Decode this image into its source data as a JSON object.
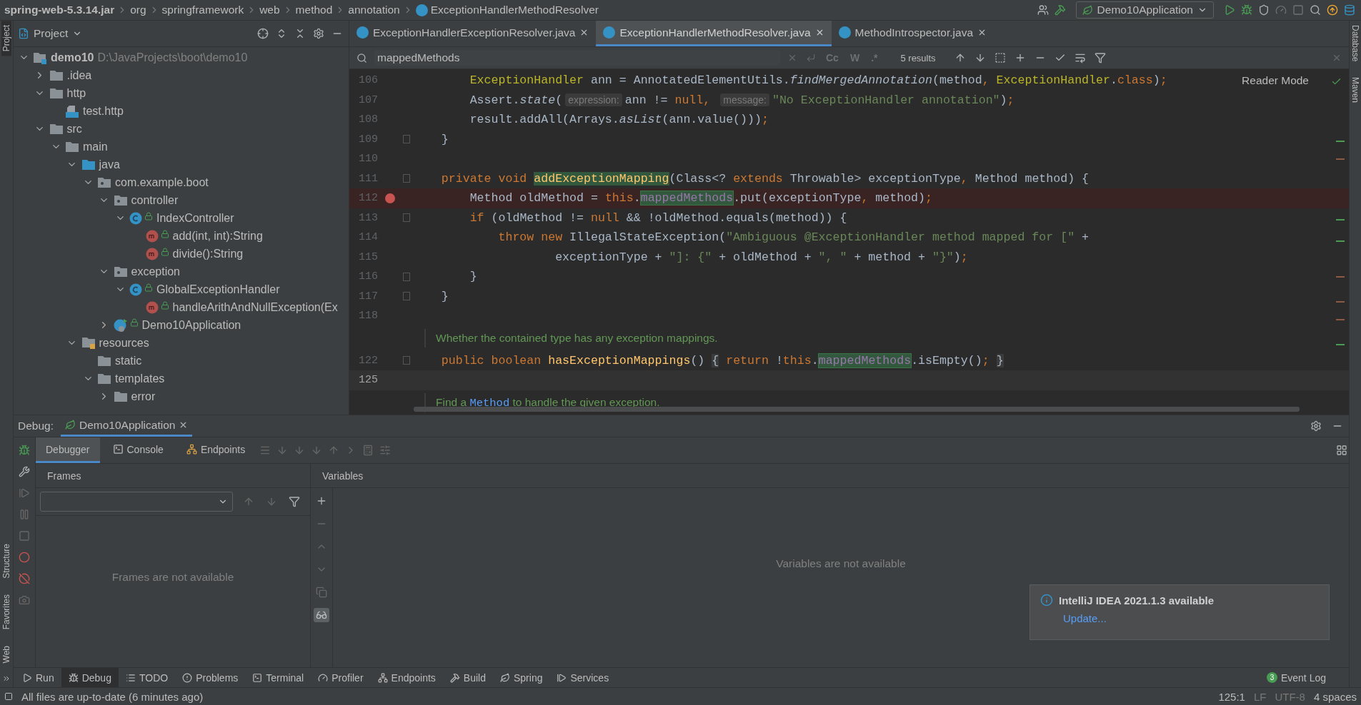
{
  "breadcrumbs": [
    "spring-web-5.3.14.jar",
    "org",
    "springframework",
    "web",
    "method",
    "annotation",
    "ExceptionHandlerMethodResolver"
  ],
  "run_config": "Demo10Application",
  "left_stripe": [
    {
      "label": "Project",
      "selected": true
    },
    {
      "label": "Structure",
      "selected": false
    },
    {
      "label": "Favorites",
      "selected": false
    },
    {
      "label": "Web",
      "selected": false
    }
  ],
  "right_stripe": [
    "Database",
    "Maven"
  ],
  "project_panel": {
    "title": "Project",
    "tree": [
      {
        "label": "demo10",
        "path": "D:\\JavaProjects\\boot\\demo10",
        "kind": "module",
        "expanded": true,
        "children": [
          {
            "label": ".idea",
            "kind": "folder",
            "expanded": false
          },
          {
            "label": "http",
            "kind": "folder",
            "expanded": true,
            "children": [
              {
                "label": "test.http",
                "kind": "http-file"
              }
            ]
          },
          {
            "label": "src",
            "kind": "folder",
            "expanded": true,
            "children": [
              {
                "label": "main",
                "kind": "folder",
                "expanded": true,
                "children": [
                  {
                    "label": "java",
                    "kind": "source-folder",
                    "expanded": true,
                    "children": [
                      {
                        "label": "com.example.boot",
                        "kind": "package",
                        "expanded": true,
                        "children": [
                          {
                            "label": "controller",
                            "kind": "package",
                            "expanded": true,
                            "children": [
                              {
                                "label": "IndexController",
                                "kind": "class",
                                "expanded": true,
                                "children": [
                                  {
                                    "label": "add(int, int):String",
                                    "kind": "method"
                                  },
                                  {
                                    "label": "divide():String",
                                    "kind": "method"
                                  }
                                ]
                              }
                            ]
                          },
                          {
                            "label": "exception",
                            "kind": "package",
                            "expanded": true,
                            "children": [
                              {
                                "label": "GlobalExceptionHandler",
                                "kind": "class",
                                "expanded": true,
                                "children": [
                                  {
                                    "label": "handleArithAndNullException(Ex",
                                    "kind": "method"
                                  }
                                ]
                              }
                            ]
                          },
                          {
                            "label": "Demo10Application",
                            "kind": "spring-app",
                            "expanded": false
                          }
                        ]
                      }
                    ]
                  },
                  {
                    "label": "resources",
                    "kind": "resources-folder",
                    "expanded": true,
                    "children": [
                      {
                        "label": "static",
                        "kind": "folder"
                      },
                      {
                        "label": "templates",
                        "kind": "folder",
                        "expanded": true,
                        "children": [
                          {
                            "label": "error",
                            "kind": "folder",
                            "expanded": false
                          }
                        ]
                      }
                    ]
                  }
                ]
              }
            ]
          }
        ]
      }
    ]
  },
  "editor_tabs": [
    {
      "label": "ExceptionHandlerExceptionResolver.java",
      "selected": false
    },
    {
      "label": "ExceptionHandlerMethodResolver.java",
      "selected": true
    },
    {
      "label": "MethodIntrospector.java",
      "selected": false
    }
  ],
  "find_bar": {
    "value": "mappedMethods",
    "options": [
      "Cc",
      "W",
      ".*"
    ],
    "result_count": "5 results"
  },
  "reader_mode": "Reader Mode",
  "code_lines": [
    {
      "kind": "code",
      "number": "106",
      "breakpoint": false,
      "caret": false,
      "fold_marker": false,
      "tokens": [
        {
          "text": "        ExceptionHandler",
          "kind": "annotation"
        },
        {
          "text": " ann = AnnotatedElementUtils.",
          "kind": "plain"
        },
        {
          "text": "findMergedAnnotation",
          "kind": "static"
        },
        {
          "text": "(method",
          "kind": "plain"
        },
        {
          "text": ", ",
          "kind": "keyword"
        },
        {
          "text": "ExceptionHandler",
          "kind": "annotation"
        },
        {
          "text": ".",
          "kind": "plain"
        },
        {
          "text": "class",
          "kind": "keyword"
        },
        {
          "text": ")",
          "kind": "plain"
        },
        {
          "text": ";",
          "kind": "keyword"
        }
      ]
    },
    {
      "kind": "code",
      "number": "107",
      "breakpoint": false,
      "caret": false,
      "fold_marker": false,
      "tokens": [
        {
          "text": "        Assert.",
          "kind": "plain"
        },
        {
          "text": "state",
          "kind": "static"
        },
        {
          "text": "(",
          "kind": "plain"
        },
        {
          "text": "expression:",
          "kind": "hint"
        },
        {
          "text": "ann != ",
          "kind": "plain"
        },
        {
          "text": "null",
          "kind": "keyword"
        },
        {
          "text": ", ",
          "kind": "keyword"
        },
        {
          "text": "message:",
          "kind": "hint"
        },
        {
          "text": "\"No ExceptionHandler annotation\"",
          "kind": "string"
        },
        {
          "text": ")",
          "kind": "plain"
        },
        {
          "text": ";",
          "kind": "keyword"
        }
      ]
    },
    {
      "kind": "code",
      "number": "108",
      "breakpoint": false,
      "caret": false,
      "fold_marker": false,
      "tokens": [
        {
          "text": "        result.addAll(Arrays.",
          "kind": "plain"
        },
        {
          "text": "asList",
          "kind": "static"
        },
        {
          "text": "(ann.value()))",
          "kind": "plain"
        },
        {
          "text": ";",
          "kind": "keyword"
        }
      ]
    },
    {
      "kind": "code",
      "number": "109",
      "breakpoint": false,
      "caret": false,
      "fold_marker": true,
      "tokens": [
        {
          "text": "    }",
          "kind": "plain"
        }
      ]
    },
    {
      "kind": "code",
      "number": "110",
      "breakpoint": false,
      "caret": false,
      "fold_marker": false
    },
    {
      "kind": "code",
      "number": "111",
      "breakpoint": false,
      "caret": false,
      "fold_marker": true,
      "tokens": [
        {
          "text": "    private void ",
          "kind": "keyword"
        },
        {
          "text": "addExceptionMapping",
          "kind": "decl-match"
        },
        {
          "text": "(Class<? ",
          "kind": "plain"
        },
        {
          "text": "extends",
          "kind": "keyword"
        },
        {
          "text": " Throwable> exceptionType",
          "kind": "plain"
        },
        {
          "text": ", ",
          "kind": "keyword"
        },
        {
          "text": "Method method) {",
          "kind": "plain"
        }
      ]
    },
    {
      "kind": "code",
      "number": "112",
      "breakpoint": true,
      "caret": false,
      "fold_marker": false,
      "tokens": [
        {
          "text": "        Method oldMethod = ",
          "kind": "plain"
        },
        {
          "text": "this",
          "kind": "keyword"
        },
        {
          "text": ".",
          "kind": "plain"
        },
        {
          "text": "mappedMethods",
          "kind": "match"
        },
        {
          "text": ".put(exceptionType",
          "kind": "plain"
        },
        {
          "text": ", ",
          "kind": "keyword"
        },
        {
          "text": "method)",
          "kind": "plain"
        },
        {
          "text": ";",
          "kind": "keyword"
        }
      ]
    },
    {
      "kind": "code",
      "number": "113",
      "breakpoint": false,
      "caret": false,
      "fold_marker": true,
      "tokens": [
        {
          "text": "        if",
          "kind": "keyword"
        },
        {
          "text": " (oldMethod != ",
          "kind": "plain"
        },
        {
          "text": "null",
          "kind": "keyword"
        },
        {
          "text": " && !oldMethod.equals(method)) {",
          "kind": "plain"
        }
      ]
    },
    {
      "kind": "code",
      "number": "114",
      "breakpoint": false,
      "caret": false,
      "fold_marker": false,
      "tokens": [
        {
          "text": "            throw new ",
          "kind": "keyword"
        },
        {
          "text": "IllegalStateException(",
          "kind": "plain"
        },
        {
          "text": "\"Ambiguous @ExceptionHandler method mapped for [\"",
          "kind": "string"
        },
        {
          "text": " +",
          "kind": "plain"
        }
      ]
    },
    {
      "kind": "code",
      "number": "115",
      "breakpoint": false,
      "caret": false,
      "fold_marker": false,
      "tokens": [
        {
          "text": "                    exceptionType + ",
          "kind": "plain"
        },
        {
          "text": "\"]: {\"",
          "kind": "string"
        },
        {
          "text": " + oldMethod + ",
          "kind": "plain"
        },
        {
          "text": "\", \"",
          "kind": "string"
        },
        {
          "text": " + method + ",
          "kind": "plain"
        },
        {
          "text": "\"}\"",
          "kind": "string"
        },
        {
          "text": ")",
          "kind": "plain"
        },
        {
          "text": ";",
          "kind": "keyword"
        }
      ]
    },
    {
      "kind": "code",
      "number": "116",
      "breakpoint": false,
      "caret": false,
      "fold_marker": true,
      "tokens": [
        {
          "text": "        }",
          "kind": "plain"
        }
      ]
    },
    {
      "kind": "code",
      "number": "117",
      "breakpoint": false,
      "caret": false,
      "fold_marker": true,
      "tokens": [
        {
          "text": "    }",
          "kind": "plain"
        }
      ]
    },
    {
      "kind": "code",
      "number": "118",
      "breakpoint": false,
      "caret": false,
      "fold_marker": false
    },
    {
      "kind": "doc",
      "tokens": [
        {
          "text": "Whether the contained type has any exception mappings.",
          "kind": "doc"
        }
      ]
    },
    {
      "kind": "code",
      "number": "122",
      "breakpoint": false,
      "caret": false,
      "fold_marker": true,
      "tokens": [
        {
          "text": "    public boolean ",
          "kind": "keyword"
        },
        {
          "text": "hasExceptionMappings",
          "kind": "decl"
        },
        {
          "text": "() ",
          "kind": "plain"
        },
        {
          "text": "{",
          "kind": "fold"
        },
        {
          "text": " return",
          "kind": "keyword"
        },
        {
          "text": " !",
          "kind": "plain"
        },
        {
          "text": "this",
          "kind": "keyword"
        },
        {
          "text": ".",
          "kind": "plain"
        },
        {
          "text": "mappedMethods",
          "kind": "match"
        },
        {
          "text": ".isEmpty()",
          "kind": "plain"
        },
        {
          "text": "; ",
          "kind": "keyword"
        },
        {
          "text": "}",
          "kind": "fold"
        }
      ]
    },
    {
      "kind": "code",
      "number": "125",
      "breakpoint": false,
      "caret": true,
      "fold_marker": false
    },
    {
      "kind": "doc",
      "tokens": [
        {
          "text": "Find a ",
          "kind": "doc"
        },
        {
          "text": "Method",
          "kind": "link"
        },
        {
          "text": " to handle the given exception.",
          "kind": "doc"
        }
      ]
    }
  ],
  "debug": {
    "label": "Debug:",
    "session": "Demo10Application",
    "tabs": [
      {
        "label": "Debugger",
        "selected": true
      },
      {
        "label": "Console",
        "selected": false
      },
      {
        "label": "Endpoints",
        "selected": false
      }
    ],
    "frames_title": "Frames",
    "frames_empty": "Frames are not available",
    "variables_title": "Variables",
    "variables_empty": "Variables are not available"
  },
  "notification": {
    "title": "IntelliJ IDEA 2021.1.3 available",
    "link": "Update..."
  },
  "tool_windows": [
    {
      "label": "Run",
      "selected": false
    },
    {
      "label": "Debug",
      "selected": true
    },
    {
      "label": "TODO",
      "selected": false
    },
    {
      "label": "Problems",
      "selected": false
    },
    {
      "label": "Terminal",
      "selected": false
    },
    {
      "label": "Profiler",
      "selected": false
    },
    {
      "label": "Endpoints",
      "selected": false
    },
    {
      "label": "Build",
      "selected": false
    },
    {
      "label": "Spring",
      "selected": false
    },
    {
      "label": "Services",
      "selected": false
    }
  ],
  "event_log": {
    "count": "3",
    "label": "Event Log"
  },
  "status_bar": {
    "message": "All files are up-to-date (6 minutes ago)",
    "items": [
      "125:1",
      "LF",
      "UTF-8",
      "4 spaces"
    ]
  }
}
